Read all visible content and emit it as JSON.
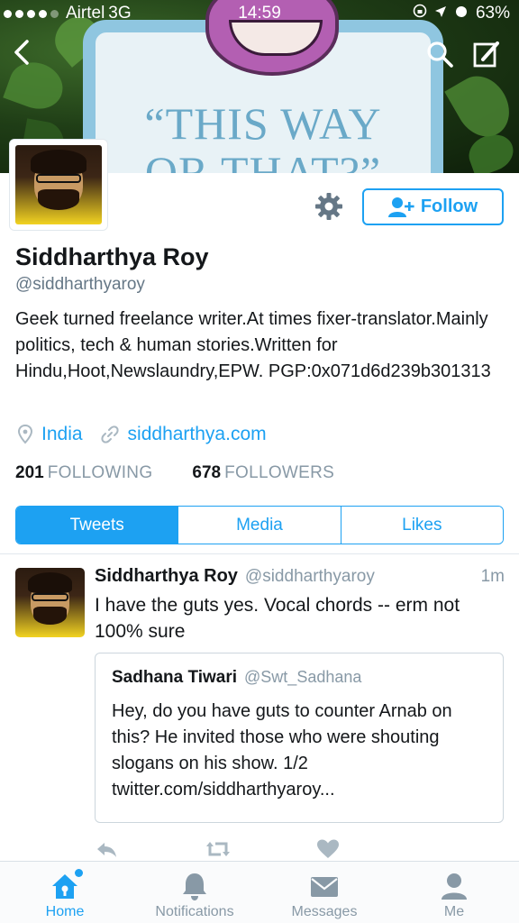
{
  "status_bar": {
    "carrier": "Airtel",
    "network": "3G",
    "time": "14:59",
    "battery": "63%"
  },
  "header": {
    "banner_sign_line1": "“THIS WAY",
    "banner_sign_line2": "OR THAT?”"
  },
  "profile": {
    "name": "Siddharthya Roy",
    "handle": "@siddharthyaroy",
    "bio": "Geek turned freelance writer.At times fixer-translator.Mainly politics, tech & human stories.Written for Hindu,Hoot,Newslaundry,EPW. PGP:0x071d6d239b301313",
    "location": "India",
    "website": "siddharthya.com",
    "following_count": "201",
    "following_label": "FOLLOWING",
    "followers_count": "678",
    "followers_label": "FOLLOWERS",
    "follow_button_label": "Follow"
  },
  "tabs": [
    {
      "label": "Tweets",
      "active": true
    },
    {
      "label": "Media",
      "active": false
    },
    {
      "label": "Likes",
      "active": false
    }
  ],
  "tweet": {
    "author": "Siddharthya Roy",
    "handle": "@siddharthyaroy",
    "time": "1m",
    "text": "I have the guts yes. Vocal chords -- erm not 100% sure",
    "quote": {
      "author": "Sadhana Tiwari",
      "handle": "@Swt_Sadhana",
      "text": "Hey, do you have guts to counter Arnab on this? He invited those who were shouting slogans on his show. 1/2 twitter.com/siddharthyaroy..."
    }
  },
  "bottom_nav": {
    "items": [
      {
        "label": "Home",
        "icon": "home-icon",
        "active": true
      },
      {
        "label": "Notifications",
        "icon": "bell-icon",
        "active": false
      },
      {
        "label": "Messages",
        "icon": "envelope-icon",
        "active": false
      },
      {
        "label": "Me",
        "icon": "person-icon",
        "active": false
      }
    ]
  },
  "colors": {
    "accent": "#1da1f2",
    "text_primary": "#14171a",
    "text_secondary": "#8899a6"
  }
}
